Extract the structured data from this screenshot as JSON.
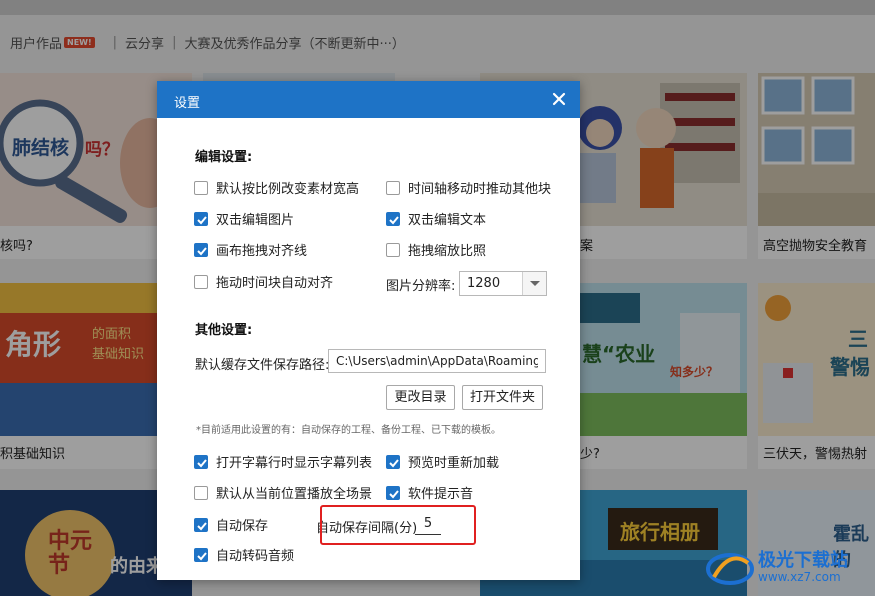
{
  "subnav": {
    "user_works": "用户作品",
    "new_badge": "NEW!",
    "sep1": "|",
    "cloud_share": "云分享",
    "sep2": "|",
    "contest_share": "大赛及优秀作品分享（不断更新中···）"
  },
  "cards": [
    {
      "caption": "核吗?",
      "thumb_text": "肺结核",
      "thumb_text2": "吗？"
    },
    {
      "caption": "",
      "thumb_text": ""
    },
    {
      "caption": "案",
      "thumb_text": ""
    },
    {
      "caption": "高空抛物安全教育",
      "thumb_text": ""
    },
    {
      "caption": "积基础知识",
      "thumb_text": "角形",
      "thumb_text2": "的面积",
      "thumb_text3": "基础知识"
    },
    {
      "caption": "",
      "thumb_text": ""
    },
    {
      "caption": "少?",
      "thumb_text": "慧“农业",
      "thumb_text2": "知多少？"
    },
    {
      "caption": "三伏天，警惕热射",
      "thumb_text": "三",
      "thumb_text2": "警惕"
    },
    {
      "caption": "",
      "thumb_text": "中元节",
      "thumb_text2": "的由来"
    },
    {
      "caption": "",
      "thumb_text": "旅行相册"
    },
    {
      "caption": "",
      "thumb_text": "霍乱的"
    }
  ],
  "dialog": {
    "title": "设置",
    "edit_section": "编辑设置:",
    "options": {
      "scale_keep_ratio": {
        "label": "默认按比例改变素材宽高",
        "checked": false
      },
      "timeline_push": {
        "label": "时间轴移动时推动其他块",
        "checked": false
      },
      "dblclick_image": {
        "label": "双击编辑图片",
        "checked": true
      },
      "dblclick_text": {
        "label": "双击编辑文本",
        "checked": true
      },
      "canvas_align": {
        "label": "画布拖拽对齐线",
        "checked": true
      },
      "drag_scale_ratio": {
        "label": "拖拽缩放比照",
        "checked": false
      },
      "drag_time_align": {
        "label": "拖动时间块自动对齐",
        "checked": false
      },
      "subtitle_list": {
        "label": "打开字幕行时显示字幕列表",
        "checked": true
      },
      "preview_reload": {
        "label": "预览时重新加载",
        "checked": true
      },
      "play_from_current": {
        "label": "默认从当前位置播放全场景",
        "checked": false
      },
      "sound_prompt": {
        "label": "软件提示音",
        "checked": true
      },
      "auto_save": {
        "label": "自动保存",
        "checked": true
      },
      "auto_transcode": {
        "label": "自动转码音频",
        "checked": true
      }
    },
    "resolution_label": "图片分辨率:",
    "resolution_value": "1280",
    "other_section": "其他设置:",
    "cache_path_label": "默认缓存文件保存路径:",
    "cache_path_value": "C:\\Users\\admin\\AppData\\Roaming\\cc",
    "change_dir_btn": "更改目录",
    "open_folder_btn": "打开文件夹",
    "note": "*目前适用此设置的有：自动保存的工程、备份工程、已下载的模板。",
    "autosave_interval_label": "自动保存间隔(分)",
    "autosave_interval_value": "5"
  },
  "watermark": {
    "text": "极光下载站",
    "url": "www.xz7.com"
  },
  "colors": {
    "accent": "#1e73c6",
    "highlight": "#e02020"
  }
}
